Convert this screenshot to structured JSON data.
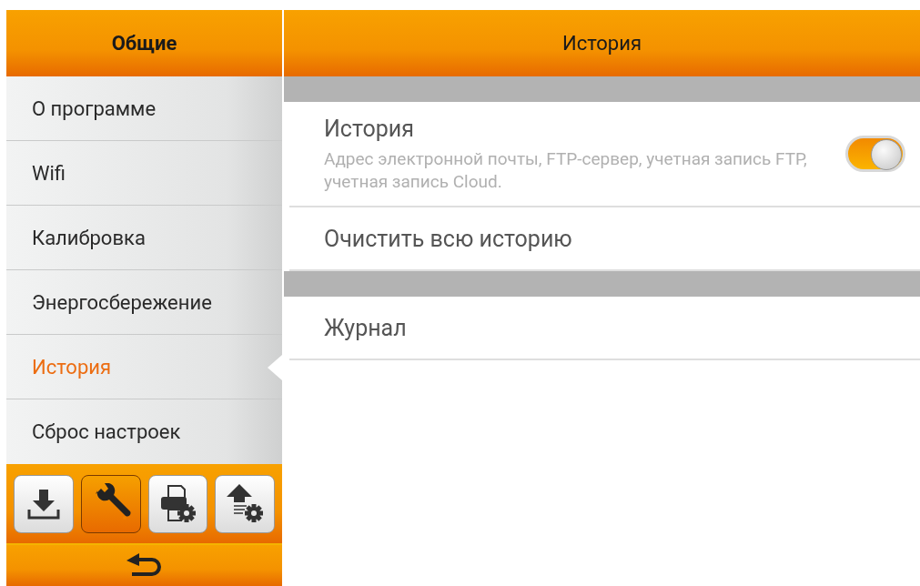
{
  "sidebar": {
    "title": "Общие",
    "items": [
      {
        "label": "О программе",
        "selected": false
      },
      {
        "label": "Wifi",
        "selected": false
      },
      {
        "label": "Калибровка",
        "selected": false
      },
      {
        "label": "Энергосбережение",
        "selected": false
      },
      {
        "label": "История",
        "selected": true
      },
      {
        "label": "Сброс настроек",
        "selected": false
      }
    ],
    "toolbar": [
      {
        "kind": "download",
        "selected": false
      },
      {
        "kind": "wrench",
        "selected": true
      },
      {
        "kind": "printer-settings",
        "selected": false
      },
      {
        "kind": "upload-settings",
        "selected": false
      }
    ]
  },
  "content": {
    "title": "История",
    "sections": [
      {
        "rows": [
          {
            "kind": "toggle",
            "label": "История",
            "description": "Адрес электронной почты, FTP-сервер, учетная запись FTP, учетная запись Cloud.",
            "on": true
          },
          {
            "kind": "plain",
            "label": "Очистить всю историю"
          }
        ]
      },
      {
        "rows": [
          {
            "kind": "plain",
            "label": "Журнал"
          }
        ]
      }
    ]
  }
}
